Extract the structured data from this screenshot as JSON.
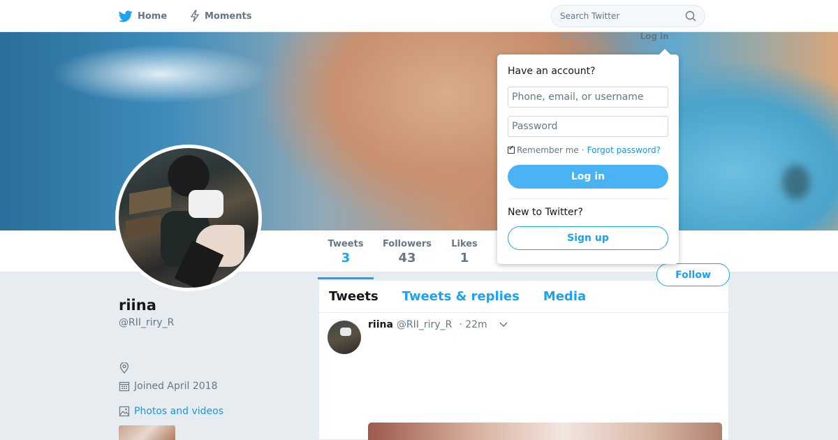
{
  "nav": {
    "home_label": "Home",
    "moments_label": "Moments",
    "search_placeholder": "Search Twitter"
  },
  "header_login": {
    "prompt": "Have an account?",
    "link": "Log in"
  },
  "stats": [
    {
      "label": "Tweets",
      "value": "3"
    },
    {
      "label": "Followers",
      "value": "43"
    },
    {
      "label": "Likes",
      "value": "1"
    }
  ],
  "follow_label": "Follow",
  "profile": {
    "name": "riina",
    "handle": "@RII_riry_R",
    "joined": "Joined April 2018",
    "photos_label": "Photos and videos"
  },
  "timeline": {
    "tabs": [
      "Tweets",
      "Tweets & replies",
      "Media"
    ],
    "tweet": {
      "name": "riina",
      "handle": "@RII_riry_R",
      "time": "· 22m"
    }
  },
  "login_dropdown": {
    "title": "Have an account?",
    "username_placeholder": "Phone, email, or username",
    "password_placeholder": "Password",
    "remember_label": "Remember me",
    "separator": "·",
    "forgot_label": "Forgot password?",
    "login_label": "Log in",
    "new_prompt": "New to Twitter?",
    "signup_label": "Sign up"
  },
  "colors": {
    "brand": "#1da1f2",
    "login_button": "#4ab3f4",
    "background": "#e6ecf0"
  }
}
